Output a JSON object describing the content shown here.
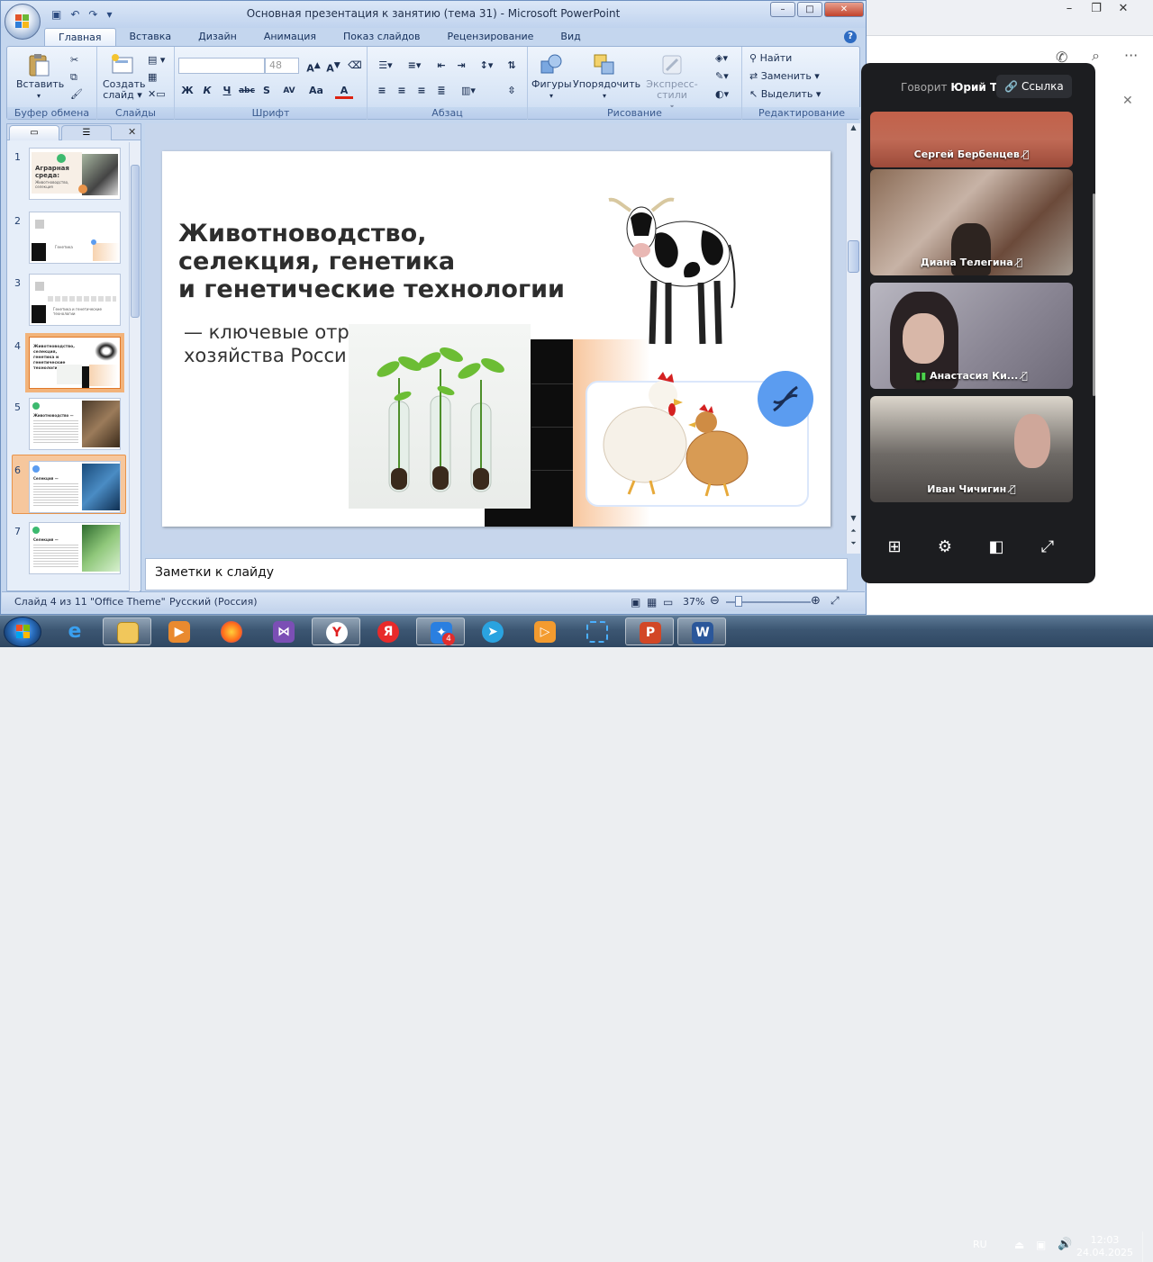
{
  "window": {
    "title": "Основная презентация к занятию (тема 31)  -  Microsoft PowerPoint"
  },
  "tabs": [
    "Главная",
    "Вставка",
    "Дизайн",
    "Анимация",
    "Показ слайдов",
    "Рецензирование",
    "Вид"
  ],
  "ribbon": {
    "clipboard": {
      "paste": "Вставить",
      "label": "Буфер обмена"
    },
    "slides": {
      "new_slide_1": "Создать",
      "new_slide_2": "слайд",
      "label": "Слайды"
    },
    "font": {
      "size": "48",
      "label": "Шрифт",
      "bold": "Ж",
      "italic": "К",
      "underline": "Ч",
      "strike": "abc",
      "shadow": "S",
      "spacing": "AV",
      "case": "Aa",
      "color": "A"
    },
    "paragraph": {
      "label": "Абзац"
    },
    "drawing": {
      "shapes": "Фигуры",
      "arrange": "Упорядочить",
      "quick_styles": "Экспресс-стили",
      "label": "Рисование"
    },
    "editing": {
      "find": "Найти",
      "replace": "Заменить",
      "select": "Выделить",
      "label": "Редактирование"
    }
  },
  "thumbnails": [
    {
      "num": "1",
      "title": "Аграрная среда:",
      "sub": "Животноводство, селекция"
    },
    {
      "num": "2",
      "title": "",
      "sub": "Генетика"
    },
    {
      "num": "3",
      "title": "",
      "sub": "Генетика и генетические технологии"
    },
    {
      "num": "4",
      "title": "Животноводство, селекция, генетика и генетические технологии",
      "sub": ""
    },
    {
      "num": "5",
      "title": "Животноводство —",
      "sub": ""
    },
    {
      "num": "6",
      "title": "Селекция —",
      "sub": ""
    },
    {
      "num": "7",
      "title": "Селекция —",
      "sub": ""
    }
  ],
  "slide": {
    "title_1": "Животноводство,",
    "title_2": "селекция, генетика",
    "title_3": "и генетические технологии",
    "subtitle_1": "— ключевые отр",
    "subtitle_2": "хозяйства Росси"
  },
  "notes": {
    "placeholder": "Заметки к слайду"
  },
  "statusbar": {
    "slide": "Слайд 4 из 11",
    "theme": "\"Office Theme\"",
    "language": "Русский (Россия)",
    "zoom": "37%"
  },
  "call": {
    "speaking_prefix": "Говорит",
    "speaker": "Юрий Т.",
    "link_button": "Ссылка",
    "participants": [
      {
        "name": "Сергей Бербенцев"
      },
      {
        "name": "Диана Телегина"
      },
      {
        "name": "Анастасия Ки..."
      },
      {
        "name": "Иван Чичигин"
      }
    ]
  },
  "taskbar": {
    "lang": "RU",
    "time": "12:03",
    "date": "24.04.2025",
    "telegram_badge": "4"
  },
  "colors": {
    "ribbon_bg": "#d8e5f6",
    "accent_orange": "#f2b37a",
    "call_bg": "#1c1d20",
    "dna_blue": "#5b9cf0"
  }
}
